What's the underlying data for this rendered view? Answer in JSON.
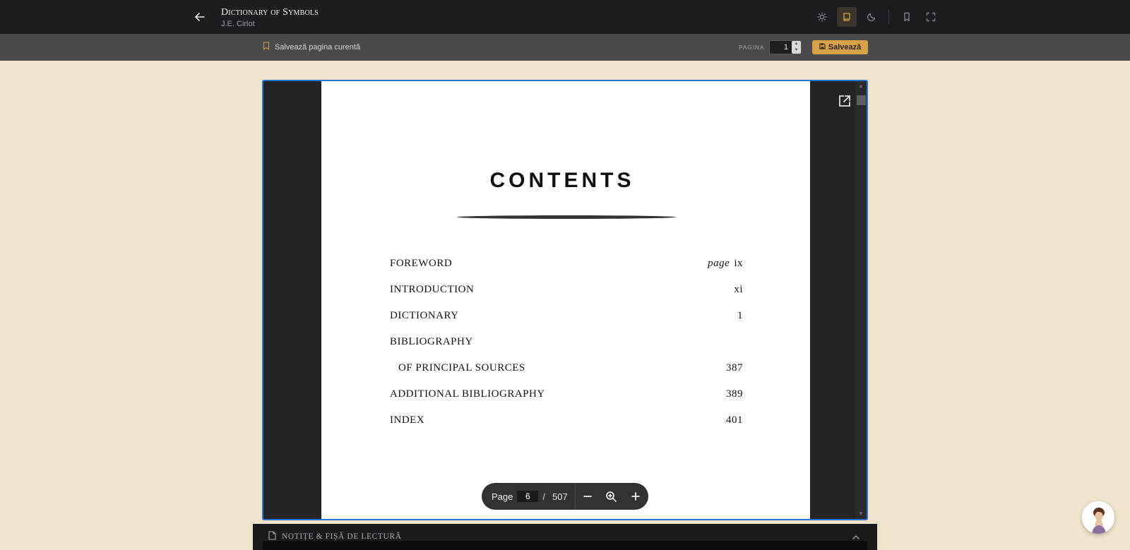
{
  "header": {
    "back_icon": "arrow-left-icon",
    "title": "Dictionary of Symbols",
    "author": "J.E. Cirlot",
    "icons": [
      "sun-icon",
      "book-reading-icon",
      "moon-icon",
      "bookmark-icon",
      "fullscreen-icon"
    ],
    "active_icon": "book-reading-icon",
    "accent": "#d9a54c"
  },
  "subbar": {
    "save_current_label": "Salvează pagina curentă",
    "page_label": "PAGINA",
    "page_value": "1",
    "save_button_label": "Salvează"
  },
  "pdf": {
    "contents_title": "CONTENTS",
    "toc": [
      {
        "label": "FOREWORD",
        "page_prefix": "page",
        "page": "ix"
      },
      {
        "label": "INTRODUCTION",
        "page_prefix": "",
        "page": "xi"
      },
      {
        "label": "DICTIONARY",
        "page_prefix": "",
        "page": "1"
      },
      {
        "label": "BIBLIOGRAPHY",
        "page_prefix": "",
        "page": ""
      },
      {
        "label": "OF PRINCIPAL SOURCES",
        "page_prefix": "",
        "page": "387"
      },
      {
        "label": "ADDITIONAL BIBLIOGRAPHY",
        "page_prefix": "",
        "page": "389"
      },
      {
        "label": "INDEX",
        "page_prefix": "",
        "page": "401"
      }
    ],
    "toolbar": {
      "page_label": "Page",
      "current_page": "6",
      "separator": "/",
      "total_pages": "507"
    }
  },
  "notes": {
    "label": "NOTIȚE & FIȘĂ DE LECTURĂ"
  },
  "frame_color": "#2a73d1"
}
